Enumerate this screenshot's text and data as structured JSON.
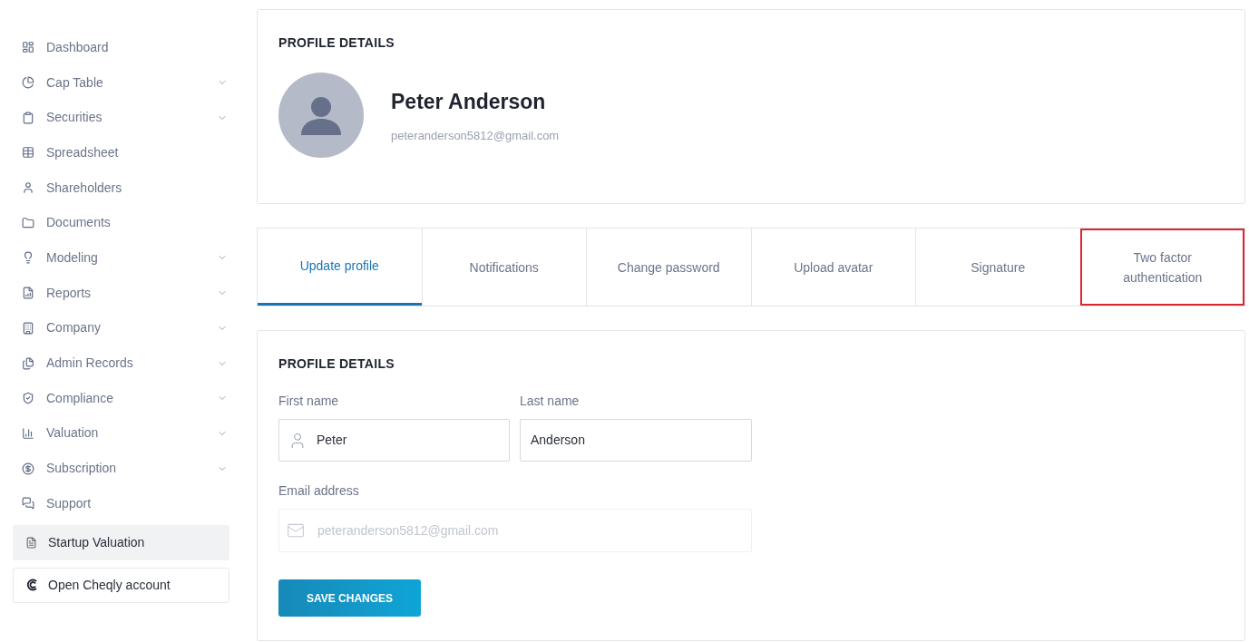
{
  "sidebar": {
    "items": [
      {
        "label": "Dashboard",
        "expandable": false
      },
      {
        "label": "Cap Table",
        "expandable": true
      },
      {
        "label": "Securities",
        "expandable": true
      },
      {
        "label": "Spreadsheet",
        "expandable": false
      },
      {
        "label": "Shareholders",
        "expandable": false
      },
      {
        "label": "Documents",
        "expandable": false
      },
      {
        "label": "Modeling",
        "expandable": true
      },
      {
        "label": "Reports",
        "expandable": true
      },
      {
        "label": "Company",
        "expandable": true
      },
      {
        "label": "Admin Records",
        "expandable": true
      },
      {
        "label": "Compliance",
        "expandable": true
      },
      {
        "label": "Valuation",
        "expandable": true
      },
      {
        "label": "Subscription",
        "expandable": true
      },
      {
        "label": "Support",
        "expandable": false
      }
    ],
    "actions": [
      {
        "label": "Startup Valuation",
        "kind": "filled"
      },
      {
        "label": "Open Cheqly account",
        "kind": "outlined"
      }
    ]
  },
  "profile_card": {
    "title": "PROFILE DETAILS",
    "name": "Peter Anderson",
    "email": "peteranderson5812@gmail.com"
  },
  "tabs": [
    {
      "label": "Update profile",
      "selected": true,
      "highlighted": false
    },
    {
      "label": "Notifications",
      "selected": false,
      "highlighted": false
    },
    {
      "label": "Change password",
      "selected": false,
      "highlighted": false
    },
    {
      "label": "Upload avatar",
      "selected": false,
      "highlighted": false
    },
    {
      "label": "Signature",
      "selected": false,
      "highlighted": false
    },
    {
      "label": "Two factor authentication",
      "selected": false,
      "highlighted": true
    }
  ],
  "form": {
    "title": "PROFILE DETAILS",
    "first_name": {
      "label": "First name",
      "value": "Peter"
    },
    "last_name": {
      "label": "Last name",
      "value": "Anderson"
    },
    "email": {
      "label": "Email address",
      "placeholder": "peteranderson5812@gmail.com",
      "disabled": true
    },
    "save_button": "SAVE CHANGES"
  }
}
